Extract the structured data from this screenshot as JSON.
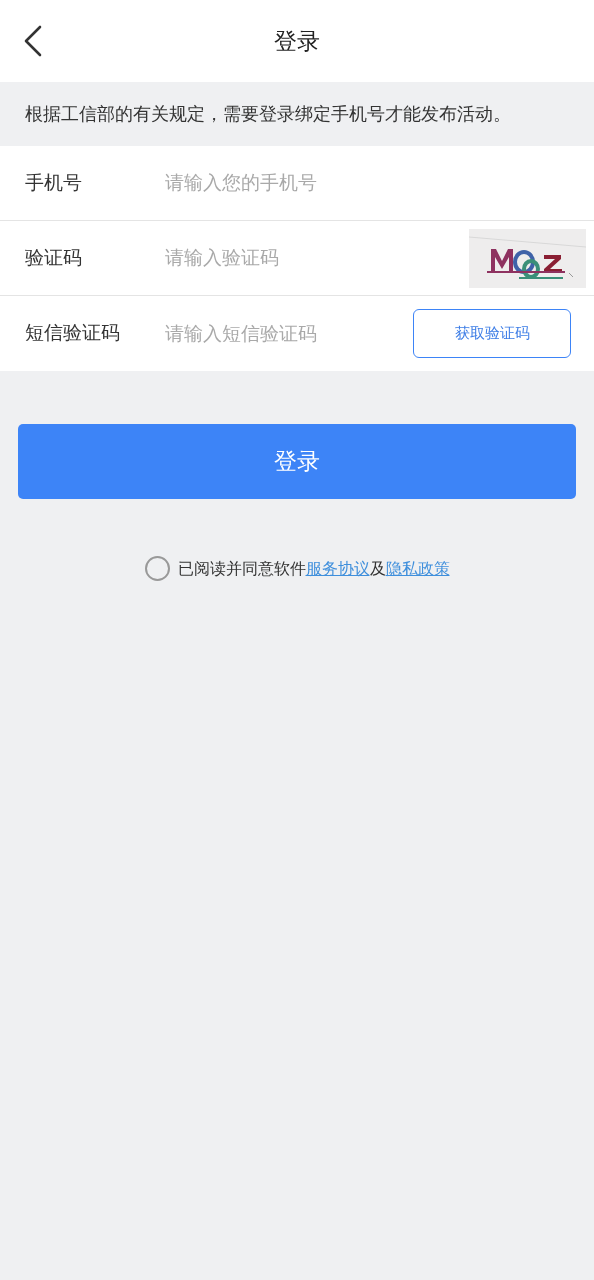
{
  "header": {
    "title": "登录"
  },
  "notice": "根据工信部的有关规定，需要登录绑定手机号才能发布活动。",
  "fields": [
    {
      "kind": "text",
      "label": "手机号",
      "placeholder": "请输入您的手机号"
    },
    {
      "kind": "captcha",
      "label": "验证码",
      "placeholder": "请输入验证码"
    },
    {
      "kind": "sms",
      "label": "短信验证码",
      "placeholder": "请输入短信验证码",
      "button": "获取验证码"
    }
  ],
  "login_button": "登录",
  "agreement": {
    "checked": false,
    "parts": [
      {
        "kind": "text",
        "text": "已阅读并同意软件"
      },
      {
        "kind": "link",
        "text": "服务协议"
      },
      {
        "kind": "text",
        "text": "及"
      },
      {
        "kind": "link",
        "text": "隐私政策"
      }
    ]
  }
}
